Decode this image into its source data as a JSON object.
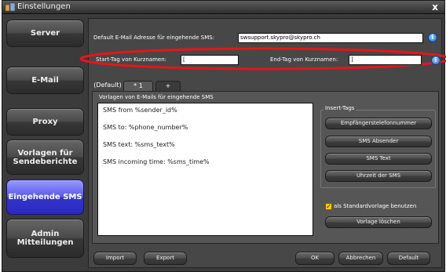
{
  "window": {
    "title": "Einstellungen",
    "close_glyph": "x"
  },
  "sidebar": {
    "items": [
      {
        "label": "Server",
        "active": false
      },
      {
        "label": "E-Mail",
        "active": false
      },
      {
        "label": "Proxy",
        "active": false
      },
      {
        "label": "Vorlagen für Sendeberichte",
        "active": false
      },
      {
        "label": "Eingehende SMS",
        "active": true
      },
      {
        "label": "Admin Mitteilungen",
        "active": false
      }
    ]
  },
  "form": {
    "default_email_label": "Default E-Mail Adresse für eingehende SMS:",
    "default_email_value": "swsupport.skypro@skypro.ch",
    "start_tag_label": "Start-Tag von Kurznamen:",
    "start_tag_value": "[",
    "end_tag_label": "End-Tag von Kurznamen:",
    "end_tag_value": "]",
    "info_glyph": "i"
  },
  "tabs": [
    "(Default)",
    "* 1",
    "+"
  ],
  "templates": {
    "label": "Vorlagen von E-Mails für eingehende SMS",
    "lines": [
      "SMS from %sender_id%",
      "SMS to: %phone_number%",
      "SMS text: %sms_text%",
      "SMS incoming time: %sms_time%"
    ]
  },
  "insert_tags": {
    "title": "Insert-Tags",
    "buttons": [
      "Empfängerstelefonnummer",
      "SMS Absender",
      "SMS Text",
      "Uhrzeit der SMS"
    ]
  },
  "standard_checkbox": {
    "label": "als Standardvorlage benutzen",
    "checked": true,
    "glyph": "✓"
  },
  "delete_template_label": "Vorlage löschen",
  "bottom_buttons": {
    "import": "Import",
    "export": "Export",
    "ok": "OK",
    "cancel": "Abbrechen",
    "default": "Default"
  },
  "colors": {
    "highlight_ellipse": "#e8141b",
    "active_sidebar": "#3a3ad6",
    "checkbox": "#ffcc00"
  }
}
